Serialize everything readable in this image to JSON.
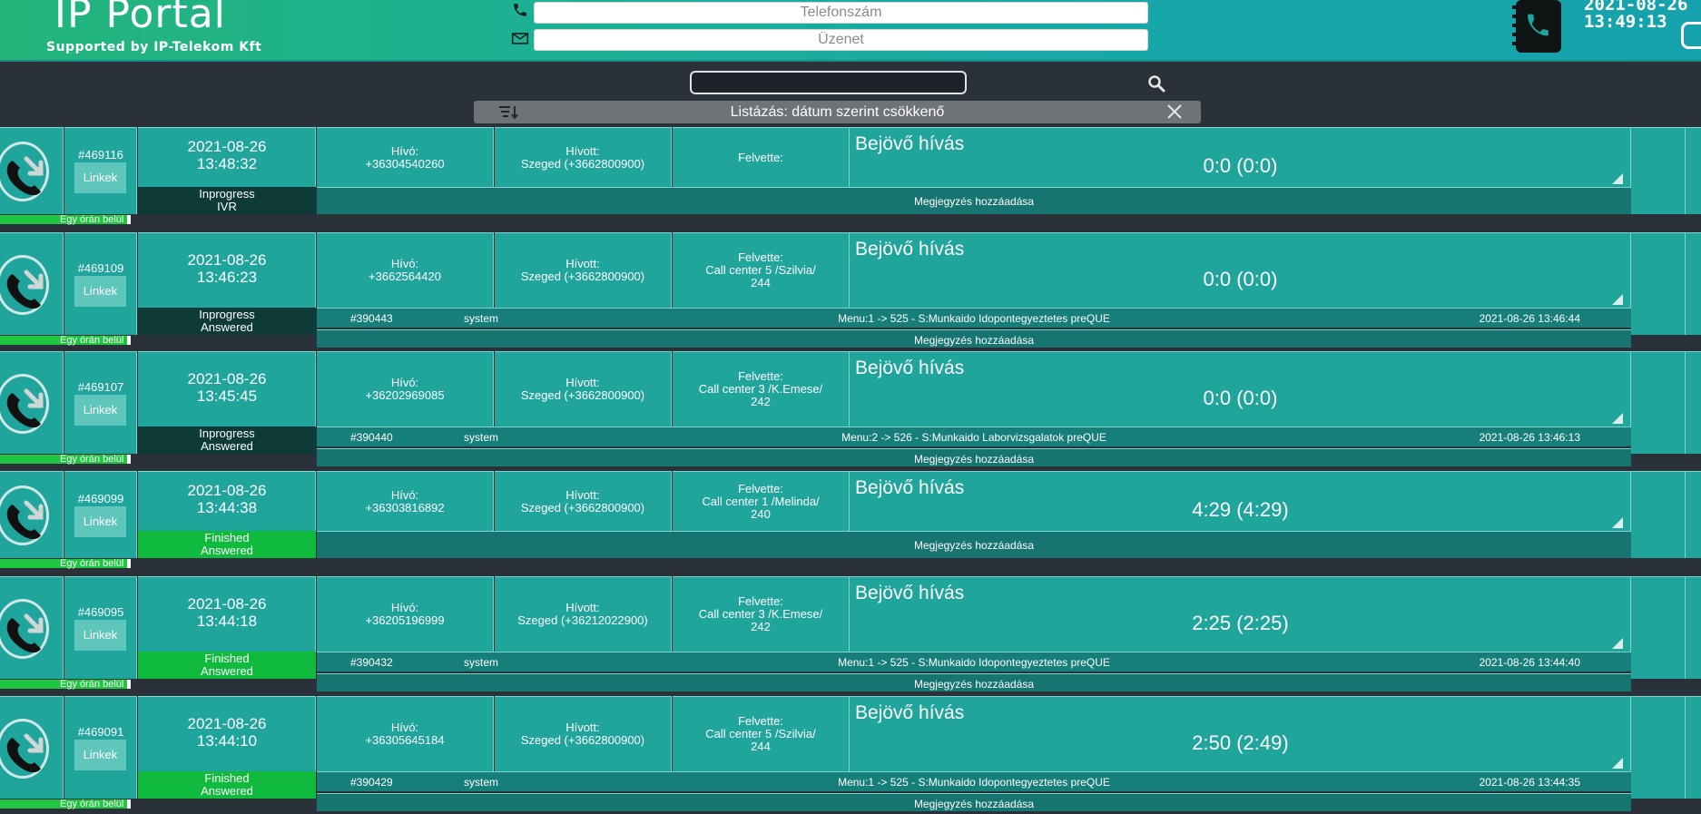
{
  "header": {
    "title": "IP Portal",
    "subtitle": "Supported by IP-Telekom Kft",
    "phone_placeholder": "Telefonszám",
    "message_placeholder": "Üzenet",
    "date": "2021-08-26",
    "time": "13:49:13"
  },
  "toolbar": {
    "search_value": "",
    "sort_label": "Listázás: dátum szerint csökkenő"
  },
  "calls": [
    {
      "id": "#469116",
      "links": "Linkek",
      "date": "2021-08-26",
      "time": "13:48:32",
      "caller_label": "Hívó:",
      "caller": "+36304540260",
      "callee_label": "Hívott:",
      "callee": "Szeged (+3662800900)",
      "answered_label": "Felvette:",
      "answered_by": "",
      "type": "Bejövő hívás",
      "duration": "0:0 (0:0)",
      "status1": "Inprogress",
      "status2": "IVR",
      "status_color": "dark",
      "log": null,
      "note": "Megjegyzés hozzáadása",
      "hour_tag": "Egy órán belül"
    },
    {
      "id": "#469109",
      "links": "Linkek",
      "date": "2021-08-26",
      "time": "13:46:23",
      "caller_label": "Hívó:",
      "caller": "+3662564420",
      "callee_label": "Hívott:",
      "callee": "Szeged (+3662800900)",
      "answered_label": "Felvette:",
      "answered_by": "Call center 5 /Szilvia/ 244",
      "type": "Bejövő hívás",
      "duration": "0:0 (0:0)",
      "status1": "Inprogress",
      "status2": "Answered",
      "status_color": "dark",
      "log": {
        "id": "#390443",
        "user": "system",
        "text": "Menu:1 -> 525 - S:Munkaido Idopontegyeztetes preQUE",
        "ts": "2021-08-26 13:46:44"
      },
      "note": "Megjegyzés hozzáadása",
      "hour_tag": "Egy órán belül"
    },
    {
      "id": "#469107",
      "links": "Linkek",
      "date": "2021-08-26",
      "time": "13:45:45",
      "caller_label": "Hívó:",
      "caller": "+36202969085",
      "callee_label": "Hívott:",
      "callee": "Szeged (+3662800900)",
      "answered_label": "Felvette:",
      "answered_by": "Call center 3 /K.Emese/ 242",
      "type": "Bejövő hívás",
      "duration": "0:0 (0:0)",
      "status1": "Inprogress",
      "status2": "Answered",
      "status_color": "dark",
      "log": {
        "id": "#390440",
        "user": "system",
        "text": "Menu:2 -> 526 - S:Munkaido Laborvizsgalatok preQUE",
        "ts": "2021-08-26 13:46:13"
      },
      "note": "Megjegyzés hozzáadása",
      "hour_tag": "Egy órán belül"
    },
    {
      "id": "#469099",
      "links": "Linkek",
      "date": "2021-08-26",
      "time": "13:44:38",
      "caller_label": "Hívó:",
      "caller": "+36303816892",
      "callee_label": "Hívott:",
      "callee": "Szeged (+3662800900)",
      "answered_label": "Felvette:",
      "answered_by": "Call center 1 /Melinda/ 240",
      "type": "Bejövő hívás",
      "duration": "4:29 (4:29)",
      "status1": "Finished",
      "status2": "Answered",
      "status_color": "green",
      "log": null,
      "note": "Megjegyzés hozzáadása",
      "hour_tag": "Egy órán belül"
    },
    {
      "id": "#469095",
      "links": "Linkek",
      "date": "2021-08-26",
      "time": "13:44:18",
      "caller_label": "Hívó:",
      "caller": "+36205196999",
      "callee_label": "Hívott:",
      "callee": "Szeged (+36212022900)",
      "answered_label": "Felvette:",
      "answered_by": "Call center 3 /K.Emese/ 242",
      "type": "Bejövő hívás",
      "duration": "2:25 (2:25)",
      "status1": "Finished",
      "status2": "Answered",
      "status_color": "green",
      "log": {
        "id": "#390432",
        "user": "system",
        "text": "Menu:1 -> 525 - S:Munkaido Idopontegyeztetes preQUE",
        "ts": "2021-08-26 13:44:40"
      },
      "note": "Megjegyzés hozzáadása",
      "hour_tag": "Egy órán belül"
    },
    {
      "id": "#469091",
      "links": "Linkek",
      "date": "2021-08-26",
      "time": "13:44:10",
      "caller_label": "Hívó:",
      "caller": "+36305645184",
      "callee_label": "Hívott:",
      "callee": "Szeged (+3662800900)",
      "answered_label": "Felvette:",
      "answered_by": "Call center 5 /Szilvia/ 244",
      "type": "Bejövő hívás",
      "duration": "2:50 (2:49)",
      "status1": "Finished",
      "status2": "Answered",
      "status_color": "green",
      "log": {
        "id": "#390429",
        "user": "system",
        "text": "Menu:1 -> 525 - S:Munkaido Idopontegyeztetes preQUE",
        "ts": "2021-08-26 13:44:35"
      },
      "note": "Megjegyzés hozzáadása",
      "hour_tag": "Egy órán belül"
    }
  ],
  "colors": {
    "accent": "#1fa59b",
    "header_start": "#23b57a",
    "status_dark": "#0e3b38",
    "status_green": "#0fba3c",
    "background": "#2b3138"
  },
  "icons": {
    "incoming_call": "incoming-call-icon",
    "phone": "phone-icon",
    "message": "envelope-icon",
    "phonebook": "phonebook-icon",
    "search": "search-icon",
    "sort": "sort-icon",
    "close": "close-icon"
  }
}
